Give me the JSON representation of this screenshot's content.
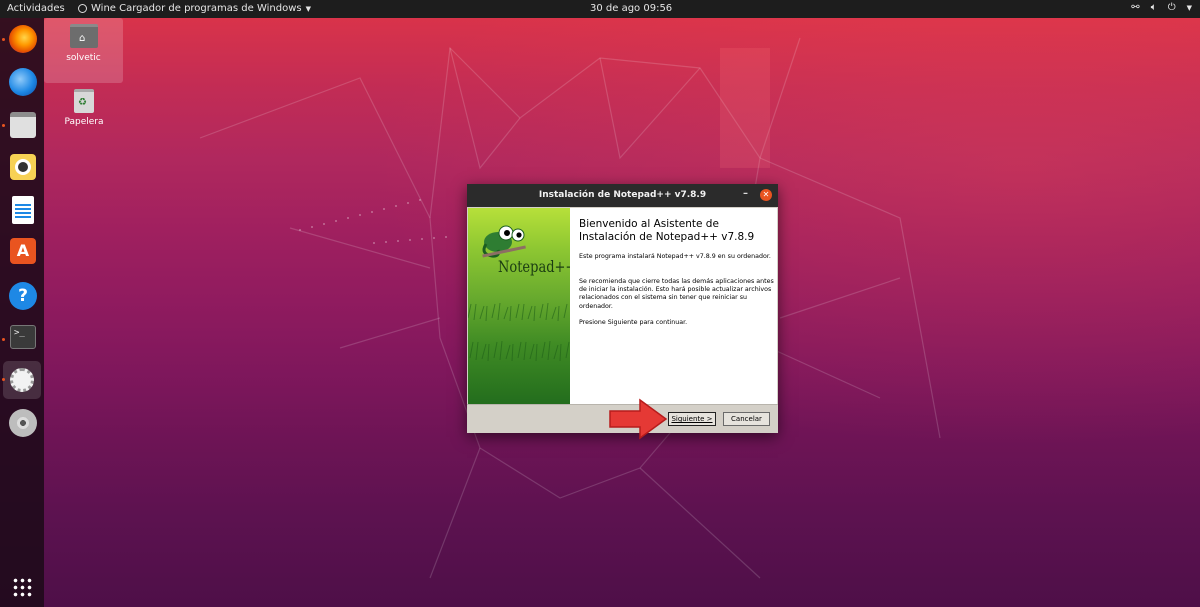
{
  "topbar": {
    "activities": "Actividades",
    "app_menu": "Wine Cargador de programas de Windows",
    "clock": "30 de ago  09:56"
  },
  "desktop": {
    "home_label": "solvetic",
    "trash_label": "Papelera"
  },
  "dock": {
    "items": [
      "firefox-icon",
      "thunderbird-icon",
      "files-icon",
      "rhythmbox-icon",
      "writer-icon",
      "software-icon",
      "help-icon",
      "terminal-icon",
      "wine-icon",
      "disc-icon"
    ],
    "apps_grid": "show-applications-icon"
  },
  "dialog": {
    "title": "Instalación de Notepad++ v7.8.9",
    "heading": "Bienvenido al Asistente de Instalación de Notepad++ v7.8.9",
    "para1": "Este programa instalará Notepad++ v7.8.9 en su ordenador.",
    "para2": "Se recomienda que cierre todas las demás aplicaciones antes de iniciar la instalación. Esto hará posible actualizar archivos relacionados con el sistema sin tener que reiniciar su ordenador.",
    "para3": "Presione Siguiente para continuar.",
    "logo_text": "Notepad++",
    "next_label": "Siguiente >",
    "cancel_label": "Cancelar"
  },
  "colors": {
    "accent": "#e95420",
    "arrow": "#e53935"
  }
}
